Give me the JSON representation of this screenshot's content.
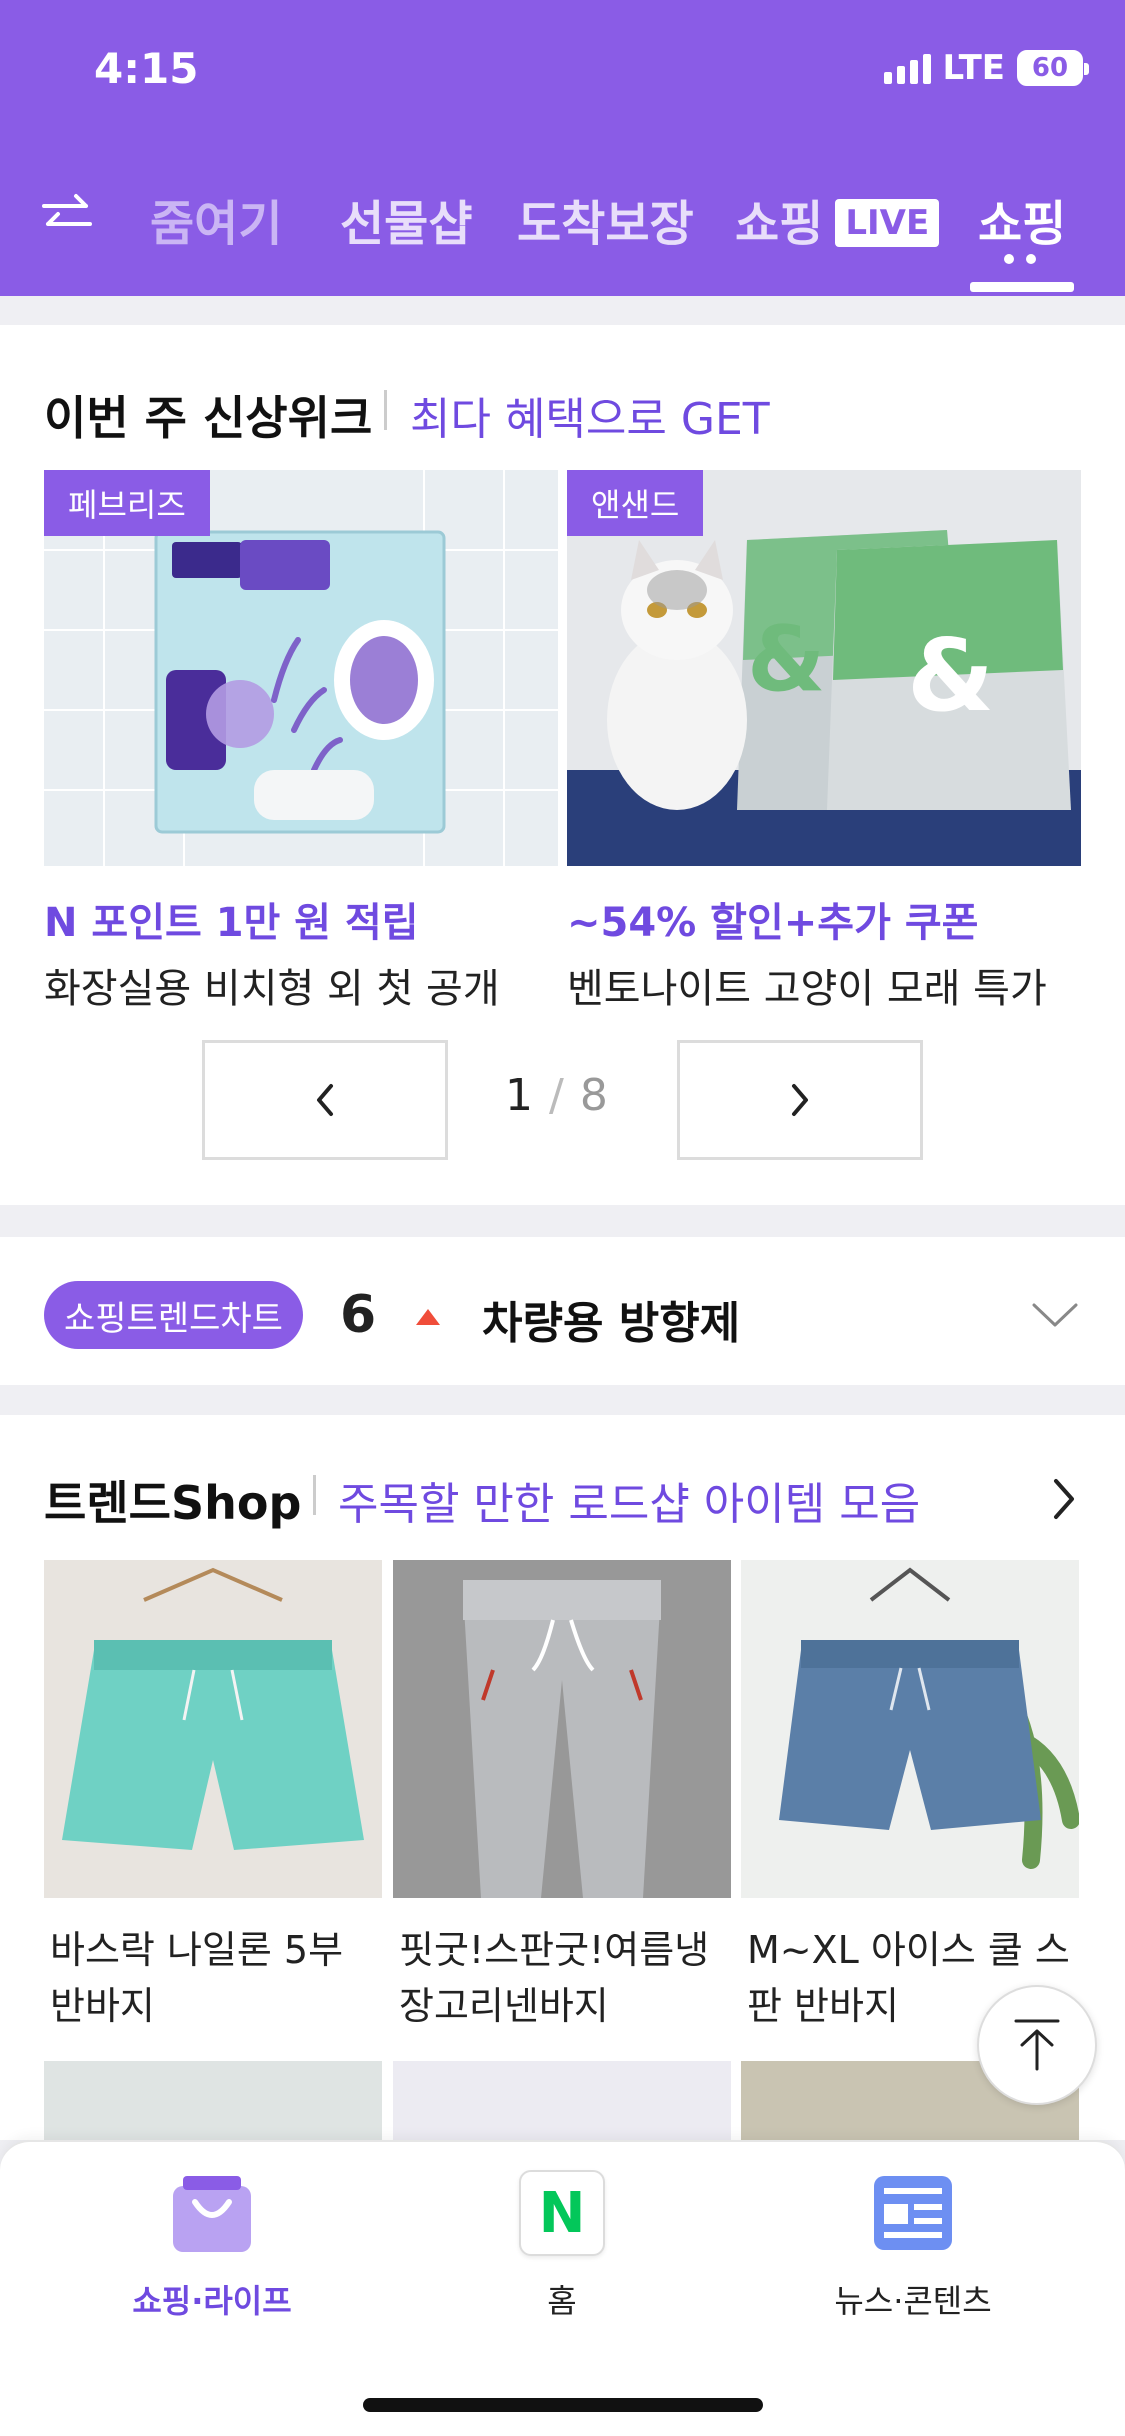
{
  "status_bar": {
    "time": "4:15",
    "network": "LTE",
    "battery": "60"
  },
  "tabs": [
    {
      "label": "줌여기"
    },
    {
      "label": "선물샵"
    },
    {
      "label": "도착보장"
    },
    {
      "label": "쇼핑",
      "badge": "LIVE"
    },
    {
      "label": "쇼핑"
    }
  ],
  "weekly": {
    "title": "이번 주 신상위크",
    "subtitle": "최다 혜택으로 GET",
    "cards": [
      {
        "brand": "페브리즈",
        "highlight": "N 포인트 1만 원 적립",
        "desc": "화장실용 비치형 외 첫 공개"
      },
      {
        "brand": "앤샌드",
        "highlight": "~54% 할인+추가 쿠폰",
        "desc": "벤토나이트 고양이 모래 특가"
      }
    ],
    "pager": {
      "current": "1",
      "total": "8"
    }
  },
  "trend_chart": {
    "badge": "쇼핑트렌드차트",
    "rank": "6",
    "keyword": "차량용 방향제"
  },
  "trend_shop": {
    "title": "트렌드Shop",
    "subtitle": "주목할 만한 로드샵 아이템 모음",
    "items": [
      {
        "name": "바스락 나일론 5부 반바지"
      },
      {
        "name": "핏굿!스판굿!여름냉 장고리넨바지"
      },
      {
        "name": "M~XL 아이스 쿨 스 판 반바지"
      }
    ]
  },
  "bottom_nav": [
    {
      "label": "쇼핑·라이프"
    },
    {
      "label": "홈",
      "icon_letter": "N"
    },
    {
      "label": "뉴스·콘텐츠"
    }
  ],
  "colors": {
    "brand": "#8a5ce6",
    "accent_text": "#6f4ae0",
    "trend_up": "#f04d3a",
    "naver_green": "#03c75a"
  }
}
